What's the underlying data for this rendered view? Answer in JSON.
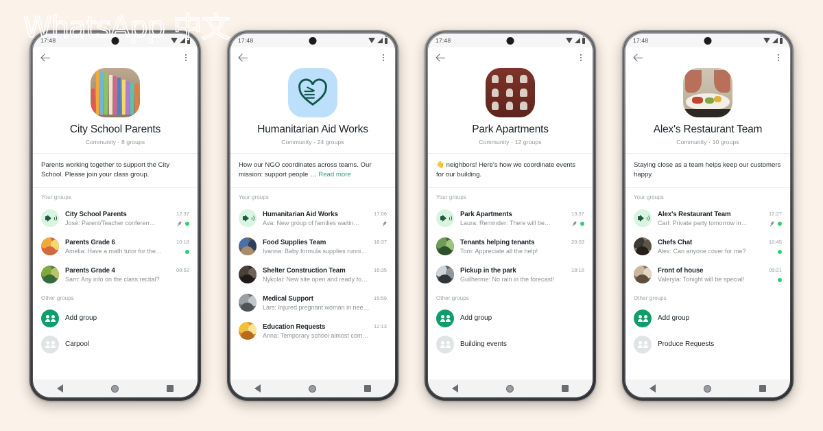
{
  "watermark": "WhatsApp 中文",
  "theme": {
    "page_bg": "#FBF2E9",
    "accent_green": "#25D366",
    "link_green": "#2E9E7C",
    "add_group_green": "#0F9D6A",
    "announcement_bg": "#D9F5E1",
    "announcement_icon": "#1F5A45"
  },
  "nav": {
    "back_icon": "triangle-back-icon",
    "home_icon": "circle-home-icon",
    "recents_icon": "square-recents-icon"
  },
  "status_bar": {
    "time": "17:48",
    "wifi_icon": "wifi-icon",
    "signal_icon": "signal-icon",
    "battery_icon": "battery-icon"
  },
  "appbar": {
    "back_icon": "back-arrow-icon",
    "menu_icon": "overflow-menu-icon"
  },
  "section_labels": {
    "your_groups": "Your groups",
    "other_groups": "Other groups"
  },
  "phones": [
    {
      "avatar_kind": "books",
      "name": "City School Parents",
      "meta": "Community · 8 groups",
      "description": "Parents working together to support the City School. Please join your class group.",
      "read_more": "",
      "your_groups": [
        {
          "avatar_kind": "announcement",
          "title": "City School Parents",
          "subtitle": "José: Parent/Teacher conferen…",
          "time": "12:37",
          "pinned": true,
          "unread": true
        },
        {
          "avatar_kind": "photo-warm",
          "title": "Parents Grade 6",
          "subtitle": "Amelia: Have a math tutor for the…",
          "time": "10:18",
          "pinned": false,
          "unread": true
        },
        {
          "avatar_kind": "photo-green",
          "title": "Parents Grade 4",
          "subtitle": "Sam: Any info on the class recital?",
          "time": "08:52",
          "pinned": false,
          "unread": false
        }
      ],
      "other_groups": [
        {
          "kind": "add",
          "label": "Add group"
        },
        {
          "kind": "group",
          "label": "Carpool"
        }
      ]
    },
    {
      "avatar_kind": "heart-hands",
      "name": "Humanitarian Aid Works",
      "meta": "Community · 24 groups",
      "description": "How our NGO coordinates across teams. Our mission: support people …",
      "read_more": "Read more",
      "your_groups": [
        {
          "avatar_kind": "announcement",
          "title": "Humanitarian Aid Works",
          "subtitle": "Ava: New group of families waitin…",
          "time": "17:06",
          "pinned": true,
          "unread": false
        },
        {
          "avatar_kind": "photo-blue",
          "title": "Food Supplies Team",
          "subtitle": "Ivanna: Baby formula supplies running …",
          "time": "18:37",
          "pinned": false,
          "unread": false
        },
        {
          "avatar_kind": "photo-dark",
          "title": "Shelter Construction Team",
          "subtitle": "Nykolai: New site open and ready for …",
          "time": "16:35",
          "pinned": false,
          "unread": false
        },
        {
          "avatar_kind": "photo-grey",
          "title": "Medical Support",
          "subtitle": "Lars: Injured pregnant woman in need…",
          "time": "15:59",
          "pinned": false,
          "unread": false
        },
        {
          "avatar_kind": "photo-yellow",
          "title": "Education Requests",
          "subtitle": "Anna: Temporary school almost comp…",
          "time": "12:13",
          "pinned": false,
          "unread": false
        }
      ],
      "other_groups": []
    },
    {
      "avatar_kind": "building",
      "name": "Park Apartments",
      "meta": "Community · 12 groups",
      "description": "👋 neighbors! Here's how we coordinate events for our building.",
      "read_more": "",
      "your_groups": [
        {
          "avatar_kind": "announcement",
          "title": "Park Apartments",
          "subtitle": "Laura: Reminder: There will be…",
          "time": "13:37",
          "pinned": true,
          "unread": true
        },
        {
          "avatar_kind": "photo-park",
          "title": "Tenants helping tenants",
          "subtitle": "Tom: Appreciate all the help!",
          "time": "20:03",
          "pinned": false,
          "unread": false
        },
        {
          "avatar_kind": "photo-sport",
          "title": "Pickup in the park",
          "subtitle": "Guilherme: No rain in the forecast!",
          "time": "18:18",
          "pinned": false,
          "unread": false
        }
      ],
      "other_groups": [
        {
          "kind": "add",
          "label": "Add group"
        },
        {
          "kind": "group",
          "label": "Building events"
        }
      ]
    },
    {
      "avatar_kind": "food",
      "name": "Alex's Restaurant Team",
      "meta": "Community · 10 groups",
      "description": "Staying close as a team helps keep our customers happy.",
      "read_more": "",
      "your_groups": [
        {
          "avatar_kind": "announcement",
          "title": "Alex's Restaurant Team",
          "subtitle": "Carl: Private party tomorrow in…",
          "time": "12:27",
          "pinned": true,
          "unread": true
        },
        {
          "avatar_kind": "photo-chefs",
          "title": "Chefs Chat",
          "subtitle": "Alex: Can anyone cover for me?",
          "time": "10:45",
          "pinned": false,
          "unread": true
        },
        {
          "avatar_kind": "photo-house",
          "title": "Front of house",
          "subtitle": "Valeryia: Tonight will be special!",
          "time": "09:21",
          "pinned": false,
          "unread": true
        }
      ],
      "other_groups": [
        {
          "kind": "add",
          "label": "Add group"
        },
        {
          "kind": "group",
          "label": "Produce Requests"
        }
      ]
    }
  ]
}
